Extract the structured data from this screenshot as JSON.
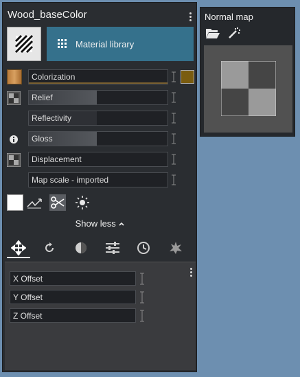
{
  "material": {
    "title": "Wood_baseColor",
    "library_label": "Material library"
  },
  "channels": [
    {
      "label": "Colorization",
      "fill": 1.0,
      "fill_color": "#7a6030"
    },
    {
      "label": "Relief",
      "fill": 0.49
    },
    {
      "label": "Reflectivity",
      "fill": 0.0
    },
    {
      "label": "Gloss",
      "fill": 0.49
    },
    {
      "label": "Displacement",
      "fill": 0.0
    },
    {
      "label": "Map scale - imported",
      "fill": 0.0
    }
  ],
  "colorization_swatch": "#7a5c10",
  "show_less": {
    "label": "Show less"
  },
  "tabs": [
    "move-icon",
    "rotate-icon",
    "contrast-icon",
    "sliders-icon",
    "clock-icon",
    "splash-icon"
  ],
  "offsets": [
    {
      "label": "X Offset"
    },
    {
      "label": "Y Offset"
    },
    {
      "label": "Z Offset"
    }
  ],
  "normal_map": {
    "title": "Normal map"
  },
  "colors": {
    "accent": "#35718c",
    "background": "#6d8fb0"
  }
}
